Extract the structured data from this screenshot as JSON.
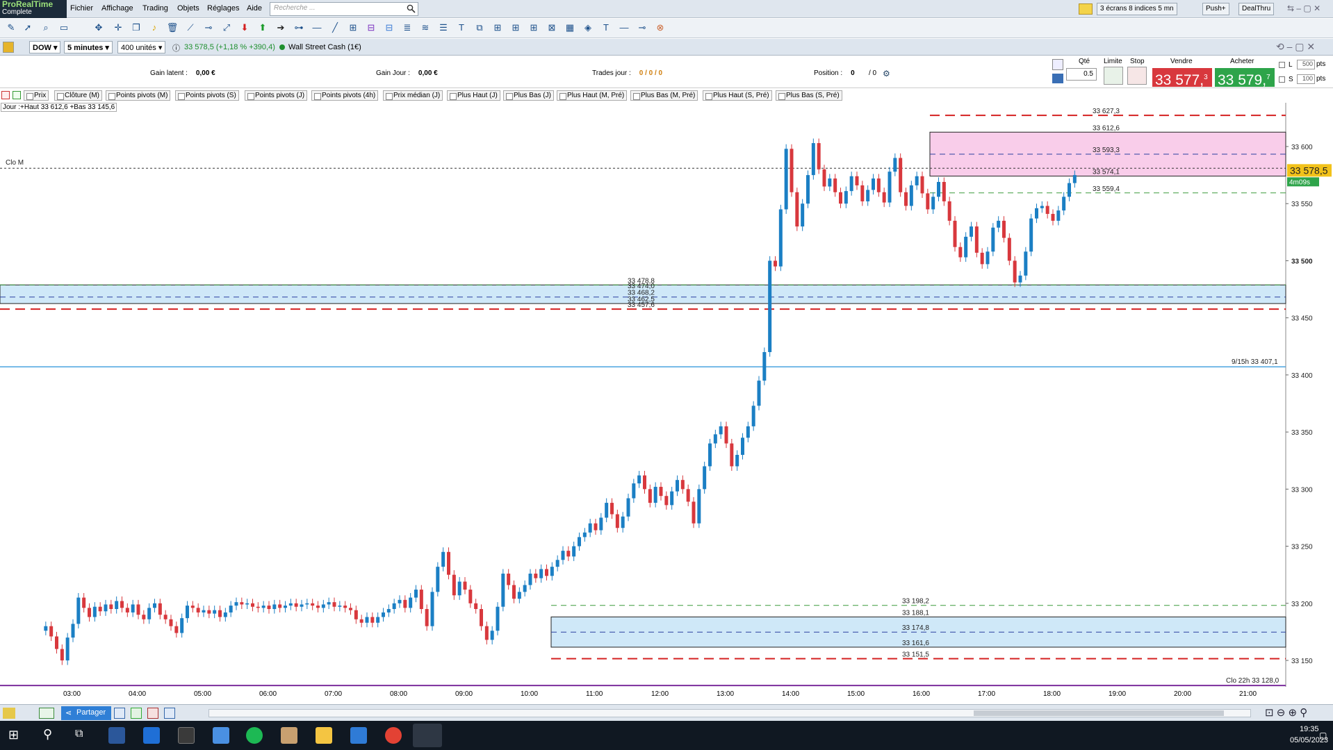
{
  "app": {
    "brand_line1": "ProRealTime",
    "brand_line2": "Complete"
  },
  "menu": [
    "Fichier",
    "Affichage",
    "Trading",
    "Objets",
    "Réglages",
    "Aide"
  ],
  "search": {
    "placeholder": "Recherche ..."
  },
  "top_right": {
    "layout": "3 écrans 8 indices 5 mn",
    "push": "Push+",
    "dealthru": "DealThru"
  },
  "instrument": {
    "symbol": "DOW",
    "timeframe": "5 minutes",
    "units": "400 unités",
    "quote": "33 578,5 (+1,18 % +390,4)",
    "name": "Wall Street Cash (1€)"
  },
  "info": {
    "gain_latent_label": "Gain latent :",
    "gain_latent": "0,00 €",
    "gain_jour_label": "Gain Jour :",
    "gain_jour": "0,00 €",
    "trades_label": "Trades jour :",
    "trades": "0 / 0 / 0",
    "position_label": "Position :",
    "position": "0",
    "position_sep": "/ 0"
  },
  "order": {
    "qte_label": "Qté",
    "qte": "0.5",
    "limite_label": "Limite",
    "stop_label": "Stop",
    "sell_label": "Vendre",
    "sell_main": "33 577,",
    "sell_small": "3",
    "buy_label": "Acheter",
    "buy_main": "33 579,",
    "buy_small": "7",
    "l_label": "L",
    "l_val": "500",
    "s_label": "S",
    "s_val": "100",
    "pts": "pts",
    "sell_color": "#d8383d",
    "buy_color": "#2ea44a"
  },
  "legend": [
    "Prix",
    "Clôture (M)",
    "Points pivots (M)",
    "Points pivots (S)",
    "Points pivots (J)",
    "Points pivots (4h)",
    "Prix médian (J)",
    "Plus Haut (J)",
    "Plus Bas (J)",
    "Plus Haut (M, Pré)",
    "Plus Bas (M, Pré)",
    "Plus Haut (S, Pré)",
    "Plus Bas (S, Pré)"
  ],
  "jour_label": "Jour :+Haut 33 612,6 +Bas 33 145,6",
  "chart_data": {
    "type": "candlestick",
    "ylim": [
      33128,
      33650
    ],
    "y_ticks": [
      33150,
      33200,
      33250,
      33300,
      33350,
      33400,
      33450,
      33500,
      33550,
      33600
    ],
    "y_tick_labels": [
      "33 150",
      "33 200",
      "33 250",
      "33 300",
      "33 350",
      "33 400",
      "33 450",
      "33 500",
      "33 550",
      "33 600"
    ],
    "x_ticks": [
      "03:00",
      "04:00",
      "05:00",
      "06:00",
      "07:00",
      "08:00",
      "09:00",
      "10:00",
      "11:00",
      "12:00",
      "13:00",
      "14:00",
      "15:00",
      "16:00",
      "17:00",
      "18:00",
      "19:00",
      "20:00",
      "21:00"
    ],
    "current_price": "33 578,5",
    "countdown": "4m09s",
    "clo_m_label": "Clo M",
    "clo_m_value": 33581,
    "right_annotations": [
      {
        "text": "9/15h 33 407,1",
        "value": 33407.1
      },
      {
        "text": "Clo 22h 33 128,0",
        "value": 33128
      }
    ],
    "level_labels": [
      {
        "text": "33 627,3",
        "value": 33627.3
      },
      {
        "text": "33 612,6",
        "value": 33612.6
      },
      {
        "text": "33 593,3",
        "value": 33593.3
      },
      {
        "text": "33 574,1",
        "value": 33574.1
      },
      {
        "text": "33 559,4",
        "value": 33559.4
      },
      {
        "text": "33 478,8",
        "value": 33478.8
      },
      {
        "text": "33 474,0",
        "value": 33474
      },
      {
        "text": "33 468,2",
        "value": 33468.2
      },
      {
        "text": "33 462,5",
        "value": 33462.5
      },
      {
        "text": "33 457,6",
        "value": 33457.6
      },
      {
        "text": "33 198,2",
        "value": 33198.2
      },
      {
        "text": "33 188,1",
        "value": 33188.1
      },
      {
        "text": "33 174,8",
        "value": 33174.8
      },
      {
        "text": "33 161,6",
        "value": 33161.6
      },
      {
        "text": "33 151,5",
        "value": 33151.5
      }
    ],
    "candles": [
      {
        "t": "02:35",
        "o": 33176,
        "c": 33180
      },
      {
        "t": "02:40",
        "o": 33180,
        "c": 33171
      },
      {
        "t": "02:45",
        "o": 33171,
        "c": 33160
      },
      {
        "t": "02:50",
        "o": 33160,
        "c": 33150
      },
      {
        "t": "02:55",
        "o": 33150,
        "c": 33170
      },
      {
        "t": "03:00",
        "o": 33170,
        "c": 33182
      },
      {
        "t": "03:05",
        "o": 33182,
        "c": 33205
      },
      {
        "t": "03:10",
        "o": 33205,
        "c": 33196
      },
      {
        "t": "03:15",
        "o": 33196,
        "c": 33188
      },
      {
        "t": "03:20",
        "o": 33188,
        "c": 33197
      },
      {
        "t": "03:25",
        "o": 33197,
        "c": 33193
      },
      {
        "t": "03:30",
        "o": 33193,
        "c": 33199
      },
      {
        "t": "03:35",
        "o": 33199,
        "c": 33195
      },
      {
        "t": "03:40",
        "o": 33195,
        "c": 33202
      },
      {
        "t": "03:45",
        "o": 33202,
        "c": 33196
      },
      {
        "t": "03:50",
        "o": 33196,
        "c": 33192
      },
      {
        "t": "03:55",
        "o": 33192,
        "c": 33199
      },
      {
        "t": "04:00",
        "o": 33199,
        "c": 33190
      },
      {
        "t": "04:05",
        "o": 33190,
        "c": 33186
      },
      {
        "t": "04:10",
        "o": 33186,
        "c": 33196
      },
      {
        "t": "04:15",
        "o": 33196,
        "c": 33200
      },
      {
        "t": "04:20",
        "o": 33200,
        "c": 33190
      },
      {
        "t": "04:25",
        "o": 33190,
        "c": 33186
      },
      {
        "t": "04:30",
        "o": 33186,
        "c": 33180
      },
      {
        "t": "04:35",
        "o": 33180,
        "c": 33174
      },
      {
        "t": "04:40",
        "o": 33174,
        "c": 33187
      },
      {
        "t": "04:45",
        "o": 33187,
        "c": 33198
      },
      {
        "t": "04:50",
        "o": 33198,
        "c": 33196
      },
      {
        "t": "04:55",
        "o": 33196,
        "c": 33192
      },
      {
        "t": "05:00",
        "o": 33192,
        "c": 33194
      },
      {
        "t": "05:05",
        "o": 33194,
        "c": 33191
      },
      {
        "t": "05:10",
        "o": 33191,
        "c": 33194
      },
      {
        "t": "05:15",
        "o": 33194,
        "c": 33188
      },
      {
        "t": "05:20",
        "o": 33188,
        "c": 33192
      },
      {
        "t": "05:25",
        "o": 33192,
        "c": 33198
      },
      {
        "t": "05:30",
        "o": 33198,
        "c": 33201
      },
      {
        "t": "05:35",
        "o": 33201,
        "c": 33199
      },
      {
        "t": "05:40",
        "o": 33199,
        "c": 33200
      },
      {
        "t": "05:45",
        "o": 33200,
        "c": 33197
      },
      {
        "t": "05:50",
        "o": 33197,
        "c": 33196
      },
      {
        "t": "05:55",
        "o": 33196,
        "c": 33198
      },
      {
        "t": "06:00",
        "o": 33198,
        "c": 33195
      },
      {
        "t": "06:05",
        "o": 33195,
        "c": 33199
      },
      {
        "t": "06:10",
        "o": 33199,
        "c": 33196
      },
      {
        "t": "06:15",
        "o": 33196,
        "c": 33198
      },
      {
        "t": "06:20",
        "o": 33198,
        "c": 33200
      },
      {
        "t": "06:25",
        "o": 33200,
        "c": 33197
      },
      {
        "t": "06:30",
        "o": 33197,
        "c": 33199
      },
      {
        "t": "06:35",
        "o": 33199,
        "c": 33200
      },
      {
        "t": "06:40",
        "o": 33200,
        "c": 33198
      },
      {
        "t": "06:45",
        "o": 33198,
        "c": 33196
      },
      {
        "t": "06:50",
        "o": 33196,
        "c": 33199
      },
      {
        "t": "06:55",
        "o": 33199,
        "c": 33201
      },
      {
        "t": "07:00",
        "o": 33201,
        "c": 33197
      },
      {
        "t": "07:05",
        "o": 33197,
        "c": 33198
      },
      {
        "t": "07:10",
        "o": 33198,
        "c": 33196
      },
      {
        "t": "07:15",
        "o": 33196,
        "c": 33194
      },
      {
        "t": "07:20",
        "o": 33194,
        "c": 33186
      },
      {
        "t": "07:25",
        "o": 33186,
        "c": 33183
      },
      {
        "t": "07:30",
        "o": 33183,
        "c": 33188
      },
      {
        "t": "07:35",
        "o": 33188,
        "c": 33183
      },
      {
        "t": "07:40",
        "o": 33183,
        "c": 33188
      },
      {
        "t": "07:45",
        "o": 33188,
        "c": 33192
      },
      {
        "t": "07:50",
        "o": 33192,
        "c": 33195
      },
      {
        "t": "07:55",
        "o": 33195,
        "c": 33200
      },
      {
        "t": "08:00",
        "o": 33200,
        "c": 33203
      },
      {
        "t": "08:05",
        "o": 33203,
        "c": 33196
      },
      {
        "t": "08:10",
        "o": 33196,
        "c": 33205
      },
      {
        "t": "08:15",
        "o": 33205,
        "c": 33212
      },
      {
        "t": "08:20",
        "o": 33212,
        "c": 33195
      },
      {
        "t": "08:25",
        "o": 33195,
        "c": 33180
      },
      {
        "t": "08:30",
        "o": 33180,
        "c": 33210
      },
      {
        "t": "08:35",
        "o": 33210,
        "c": 33232
      },
      {
        "t": "08:40",
        "o": 33232,
        "c": 33245
      },
      {
        "t": "08:45",
        "o": 33245,
        "c": 33225
      },
      {
        "t": "08:50",
        "o": 33225,
        "c": 33207
      },
      {
        "t": "08:55",
        "o": 33207,
        "c": 33219
      },
      {
        "t": "09:00",
        "o": 33219,
        "c": 33212
      },
      {
        "t": "09:05",
        "o": 33212,
        "c": 33200
      },
      {
        "t": "09:10",
        "o": 33200,
        "c": 33195
      },
      {
        "t": "09:15",
        "o": 33195,
        "c": 33180
      },
      {
        "t": "09:20",
        "o": 33180,
        "c": 33168
      },
      {
        "t": "09:25",
        "o": 33168,
        "c": 33176
      },
      {
        "t": "09:30",
        "o": 33176,
        "c": 33197
      },
      {
        "t": "09:35",
        "o": 33197,
        "c": 33226
      },
      {
        "t": "09:40",
        "o": 33226,
        "c": 33216
      },
      {
        "t": "09:45",
        "o": 33216,
        "c": 33204
      },
      {
        "t": "09:50",
        "o": 33204,
        "c": 33210
      },
      {
        "t": "09:55",
        "o": 33210,
        "c": 33216
      },
      {
        "t": "10:00",
        "o": 33216,
        "c": 33226
      },
      {
        "t": "10:05",
        "o": 33226,
        "c": 33222
      },
      {
        "t": "10:10",
        "o": 33222,
        "c": 33230
      },
      {
        "t": "10:15",
        "o": 33230,
        "c": 33224
      },
      {
        "t": "10:20",
        "o": 33224,
        "c": 33232
      },
      {
        "t": "10:25",
        "o": 33232,
        "c": 33238
      },
      {
        "t": "10:30",
        "o": 33238,
        "c": 33246
      },
      {
        "t": "10:35",
        "o": 33246,
        "c": 33241
      },
      {
        "t": "10:40",
        "o": 33241,
        "c": 33250
      },
      {
        "t": "10:45",
        "o": 33250,
        "c": 33258
      },
      {
        "t": "10:50",
        "o": 33258,
        "c": 33262
      },
      {
        "t": "10:55",
        "o": 33262,
        "c": 33270
      },
      {
        "t": "11:00",
        "o": 33270,
        "c": 33264
      },
      {
        "t": "11:05",
        "o": 33264,
        "c": 33275
      },
      {
        "t": "11:10",
        "o": 33275,
        "c": 33288
      },
      {
        "t": "11:15",
        "o": 33288,
        "c": 33278
      },
      {
        "t": "11:20",
        "o": 33278,
        "c": 33266
      },
      {
        "t": "11:25",
        "o": 33266,
        "c": 33276
      },
      {
        "t": "11:30",
        "o": 33276,
        "c": 33292
      },
      {
        "t": "11:35",
        "o": 33292,
        "c": 33305
      },
      {
        "t": "11:40",
        "o": 33305,
        "c": 33312
      },
      {
        "t": "11:45",
        "o": 33312,
        "c": 33300
      },
      {
        "t": "11:50",
        "o": 33300,
        "c": 33288
      },
      {
        "t": "11:55",
        "o": 33288,
        "c": 33302
      },
      {
        "t": "12:00",
        "o": 33302,
        "c": 33294
      },
      {
        "t": "12:05",
        "o": 33294,
        "c": 33286
      },
      {
        "t": "12:10",
        "o": 33286,
        "c": 33298
      },
      {
        "t": "12:15",
        "o": 33298,
        "c": 33308
      },
      {
        "t": "12:20",
        "o": 33308,
        "c": 33300
      },
      {
        "t": "12:25",
        "o": 33300,
        "c": 33289
      },
      {
        "t": "12:30",
        "o": 33289,
        "c": 33270
      },
      {
        "t": "12:35",
        "o": 33270,
        "c": 33300
      },
      {
        "t": "12:40",
        "o": 33300,
        "c": 33320
      },
      {
        "t": "12:45",
        "o": 33320,
        "c": 33340
      },
      {
        "t": "12:50",
        "o": 33340,
        "c": 33348
      },
      {
        "t": "12:55",
        "o": 33348,
        "c": 33355
      },
      {
        "t": "13:00",
        "o": 33355,
        "c": 33340
      },
      {
        "t": "13:05",
        "o": 33340,
        "c": 33320
      },
      {
        "t": "13:10",
        "o": 33320,
        "c": 33330
      },
      {
        "t": "13:15",
        "o": 33330,
        "c": 33345
      },
      {
        "t": "13:20",
        "o": 33345,
        "c": 33355
      },
      {
        "t": "13:25",
        "o": 33355,
        "c": 33373
      },
      {
        "t": "13:30",
        "o": 33373,
        "c": 33395
      },
      {
        "t": "13:35",
        "o": 33395,
        "c": 33420
      },
      {
        "t": "13:40",
        "o": 33420,
        "c": 33500
      },
      {
        "t": "13:45",
        "o": 33500,
        "c": 33495
      },
      {
        "t": "13:50",
        "o": 33495,
        "c": 33545
      },
      {
        "t": "13:55",
        "o": 33545,
        "c": 33598
      },
      {
        "t": "14:00",
        "o": 33598,
        "c": 33560
      },
      {
        "t": "14:05",
        "o": 33560,
        "c": 33530
      },
      {
        "t": "14:10",
        "o": 33530,
        "c": 33550
      },
      {
        "t": "14:15",
        "o": 33550,
        "c": 33575
      },
      {
        "t": "14:20",
        "o": 33575,
        "c": 33603
      },
      {
        "t": "14:25",
        "o": 33603,
        "c": 33580
      },
      {
        "t": "14:30",
        "o": 33580,
        "c": 33565
      },
      {
        "t": "14:35",
        "o": 33565,
        "c": 33572
      },
      {
        "t": "14:40",
        "o": 33572,
        "c": 33560
      },
      {
        "t": "14:45",
        "o": 33560,
        "c": 33550
      },
      {
        "t": "14:50",
        "o": 33550,
        "c": 33561
      },
      {
        "t": "14:55",
        "o": 33561,
        "c": 33574
      },
      {
        "t": "15:00",
        "o": 33574,
        "c": 33566
      },
      {
        "t": "15:05",
        "o": 33566,
        "c": 33552
      },
      {
        "t": "15:10",
        "o": 33552,
        "c": 33562
      },
      {
        "t": "15:15",
        "o": 33562,
        "c": 33572
      },
      {
        "t": "15:20",
        "o": 33572,
        "c": 33560
      },
      {
        "t": "15:25",
        "o": 33560,
        "c": 33551
      },
      {
        "t": "15:30",
        "o": 33551,
        "c": 33578
      },
      {
        "t": "15:35",
        "o": 33578,
        "c": 33590
      },
      {
        "t": "15:40",
        "o": 33590,
        "c": 33560
      },
      {
        "t": "15:45",
        "o": 33560,
        "c": 33548
      },
      {
        "t": "15:50",
        "o": 33548,
        "c": 33566
      },
      {
        "t": "15:55",
        "o": 33566,
        "c": 33574
      },
      {
        "t": "16:00",
        "o": 33574,
        "c": 33559
      },
      {
        "t": "16:05",
        "o": 33559,
        "c": 33545
      },
      {
        "t": "16:10",
        "o": 33545,
        "c": 33556
      },
      {
        "t": "16:15",
        "o": 33556,
        "c": 33569
      },
      {
        "t": "16:20",
        "o": 33569,
        "c": 33552
      },
      {
        "t": "16:25",
        "o": 33552,
        "c": 33535
      },
      {
        "t": "16:30",
        "o": 33535,
        "c": 33512
      },
      {
        "t": "16:35",
        "o": 33512,
        "c": 33503
      },
      {
        "t": "16:40",
        "o": 33503,
        "c": 33521
      },
      {
        "t": "16:45",
        "o": 33521,
        "c": 33530
      },
      {
        "t": "16:50",
        "o": 33530,
        "c": 33507
      },
      {
        "t": "16:55",
        "o": 33507,
        "c": 33497
      },
      {
        "t": "17:00",
        "o": 33497,
        "c": 33508
      },
      {
        "t": "17:05",
        "o": 33508,
        "c": 33529
      },
      {
        "t": "17:10",
        "o": 33529,
        "c": 33535
      },
      {
        "t": "17:15",
        "o": 33535,
        "c": 33520
      },
      {
        "t": "17:20",
        "o": 33520,
        "c": 33500
      },
      {
        "t": "17:25",
        "o": 33500,
        "c": 33481
      },
      {
        "t": "17:30",
        "o": 33481,
        "c": 33487
      },
      {
        "t": "17:35",
        "o": 33487,
        "c": 33508
      },
      {
        "t": "17:40",
        "o": 33508,
        "c": 33537
      },
      {
        "t": "17:45",
        "o": 33537,
        "c": 33546
      },
      {
        "t": "17:50",
        "o": 33546,
        "c": 33548
      },
      {
        "t": "17:55",
        "o": 33548,
        "c": 33541
      },
      {
        "t": "18:00",
        "o": 33541,
        "c": 33535
      },
      {
        "t": "18:05",
        "o": 33535,
        "c": 33544
      },
      {
        "t": "18:10",
        "o": 33544,
        "c": 33556
      },
      {
        "t": "18:15",
        "o": 33556,
        "c": 33568
      },
      {
        "t": "18:20",
        "o": 33568,
        "c": 33575
      }
    ]
  },
  "bottombar": {
    "partager": "Partager"
  },
  "taskbar": {
    "time": "19:35",
    "date": "05/05/2023"
  }
}
